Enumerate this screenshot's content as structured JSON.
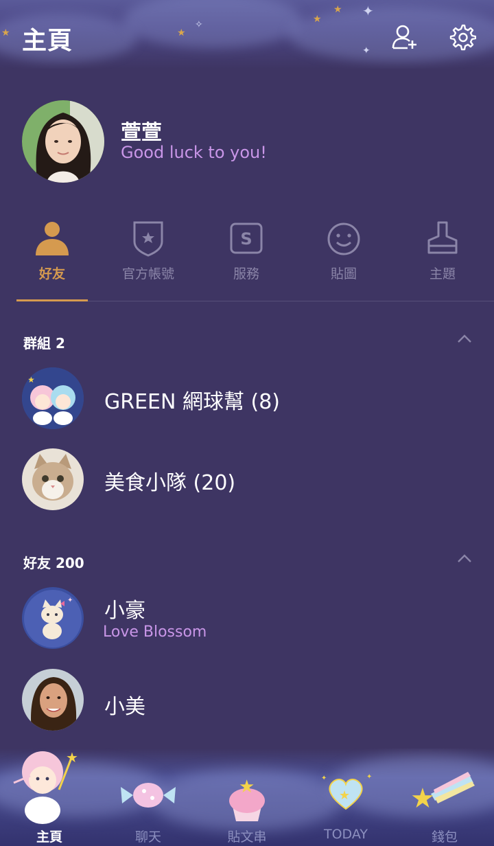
{
  "header": {
    "title": "主頁",
    "add_friend_icon": "add-friend-icon",
    "settings_icon": "gear-icon"
  },
  "profile": {
    "name": "萱萱",
    "status": "Good luck to you!"
  },
  "tabs": [
    {
      "label": "好友",
      "icon": "person-icon",
      "active": true
    },
    {
      "label": "官方帳號",
      "icon": "official-shield-icon",
      "active": false
    },
    {
      "label": "服務",
      "icon": "services-s-icon",
      "active": false
    },
    {
      "label": "貼圖",
      "icon": "smiley-icon",
      "active": false
    },
    {
      "label": "主題",
      "icon": "theme-brush-icon",
      "active": false
    }
  ],
  "groups": {
    "title": "群組 2",
    "items": [
      {
        "name": "GREEN 網球幫 (8)"
      },
      {
        "name": "美食小隊 (20)"
      }
    ]
  },
  "friends": {
    "title": "好友 200",
    "items": [
      {
        "name": "小豪",
        "status": "Love Blossom"
      },
      {
        "name": "小美",
        "status": ""
      }
    ]
  },
  "bottom_nav": [
    {
      "label": "主頁",
      "active": true
    },
    {
      "label": "聊天",
      "active": false
    },
    {
      "label": "貼文串",
      "active": false
    },
    {
      "label": "TODAY",
      "active": false
    },
    {
      "label": "錢包",
      "active": false
    }
  ],
  "colors": {
    "background": "#3e3563",
    "accent": "#d59a4f",
    "status_text": "#c996e8",
    "muted": "#8b85a8"
  }
}
